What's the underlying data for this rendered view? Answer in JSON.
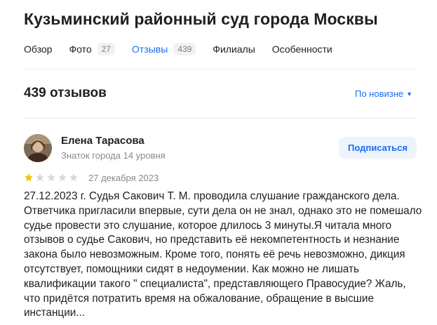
{
  "org": {
    "title": "Кузьминский районный суд города Москвы"
  },
  "tabs": [
    {
      "label": "Обзор",
      "count": ""
    },
    {
      "label": "Фото",
      "count": "27"
    },
    {
      "label": "Отзывы",
      "count": "439"
    },
    {
      "label": "Филиалы",
      "count": ""
    },
    {
      "label": "Особенности",
      "count": ""
    }
  ],
  "reviews": {
    "count_label": "439 отзывов",
    "sort_label": "По новизне"
  },
  "review": {
    "author_name": "Елена Тарасова",
    "author_level": "Знаток города 14 уровня",
    "subscribe_label": "Подписаться",
    "rating": 1,
    "rating_max": 5,
    "date": "27 декабря 2023",
    "text": "27.12.2023 г. Судья Сакович Т. М. проводила слушание гражданского дела. Ответчика пригласили впервые, сути дела он не знал, однако это не помешало судье провести это слушание, которое длилось 3 минуты.Я читала много отзывов о судье Сакович, но представить её некомпетентность и незнание закона было невозможным. Кроме того, понять её речь невозможно, дикция отсутствует, помощники сидят в недоумении. Как можно не лишать квалификации такого \" специалиста\", представляющего Правосудие? Жаль, что придётся потратить время на обжалование, обращение в высшие инстанции..."
  },
  "colors": {
    "accent": "#1a6ff0",
    "star_filled": "#fbbd00",
    "star_empty": "#d9d9d9"
  }
}
